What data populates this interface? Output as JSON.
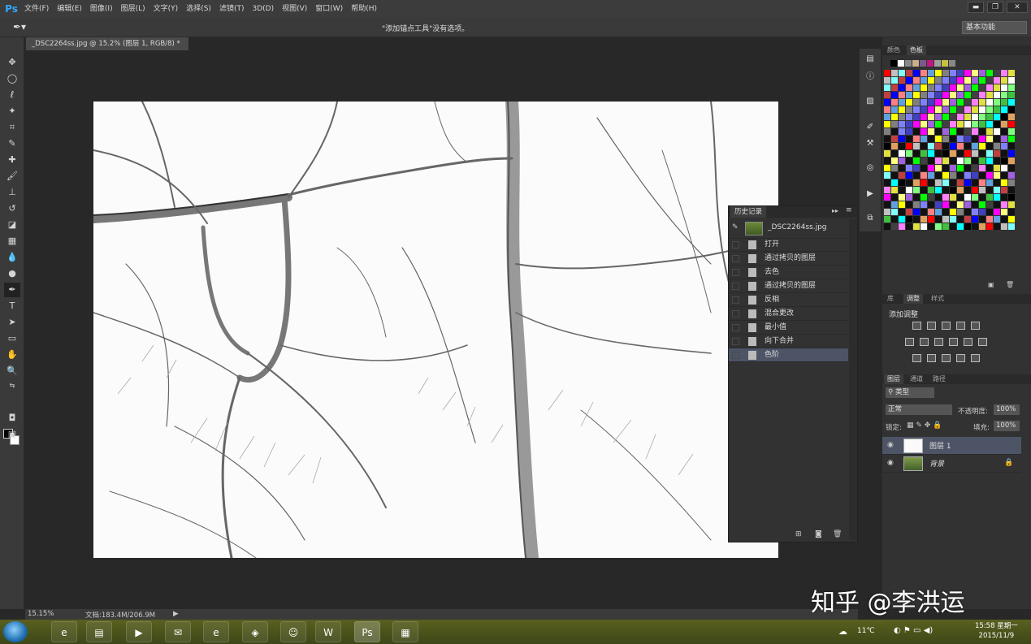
{
  "app": {
    "logo": "Ps"
  },
  "menu": [
    "文件(F)",
    "编辑(E)",
    "图像(I)",
    "图层(L)",
    "文字(Y)",
    "选择(S)",
    "滤镜(T)",
    "3D(D)",
    "视图(V)",
    "窗口(W)",
    "帮助(H)"
  ],
  "window_buttons": {
    "minimize": "▬",
    "restore": "❐",
    "close": "✕"
  },
  "options_bar": {
    "message": "\"添加锚点工具\"没有选项。",
    "workspace": "基本功能"
  },
  "document": {
    "tab_label": "_DSC2264ss.jpg @ 15.2% (图层 1, RGB/8) *",
    "tab_close": "×"
  },
  "status": {
    "zoom": "15.15%",
    "doc_size": "文档:183.4M/206.9M"
  },
  "history": {
    "tab": "历史记录",
    "snapshot": "_DSC2264ss.jpg",
    "items": [
      "打开",
      "通过拷贝的图层",
      "去色",
      "通过拷贝的图层",
      "反相",
      "混合更改",
      "最小值",
      "向下合并",
      "色阶"
    ],
    "selected_index": 8
  },
  "color_panel": {
    "tabs": [
      "颜色",
      "色板"
    ],
    "active_tab": 1
  },
  "adjustments_panel": {
    "tabs": [
      "库",
      "调整",
      "样式"
    ],
    "active_tab": 1,
    "title": "添加调整"
  },
  "layers_panel": {
    "tabs": [
      "图层",
      "通道",
      "路径"
    ],
    "active_tab": 0,
    "filter": "类型",
    "blend_mode": "正常",
    "opacity_label": "不透明度:",
    "opacity": "100%",
    "lock_label": "锁定:",
    "fill_label": "填充:",
    "fill": "100%",
    "layers": [
      {
        "name": "图层 1",
        "selected": true,
        "locked": false
      },
      {
        "name": "背景",
        "selected": false,
        "locked": true
      }
    ]
  },
  "taskbar": {
    "temperature": "11℃",
    "time": "15:58 星期一",
    "date": "2015/11/9"
  },
  "watermark": "知乎 @李洪运"
}
